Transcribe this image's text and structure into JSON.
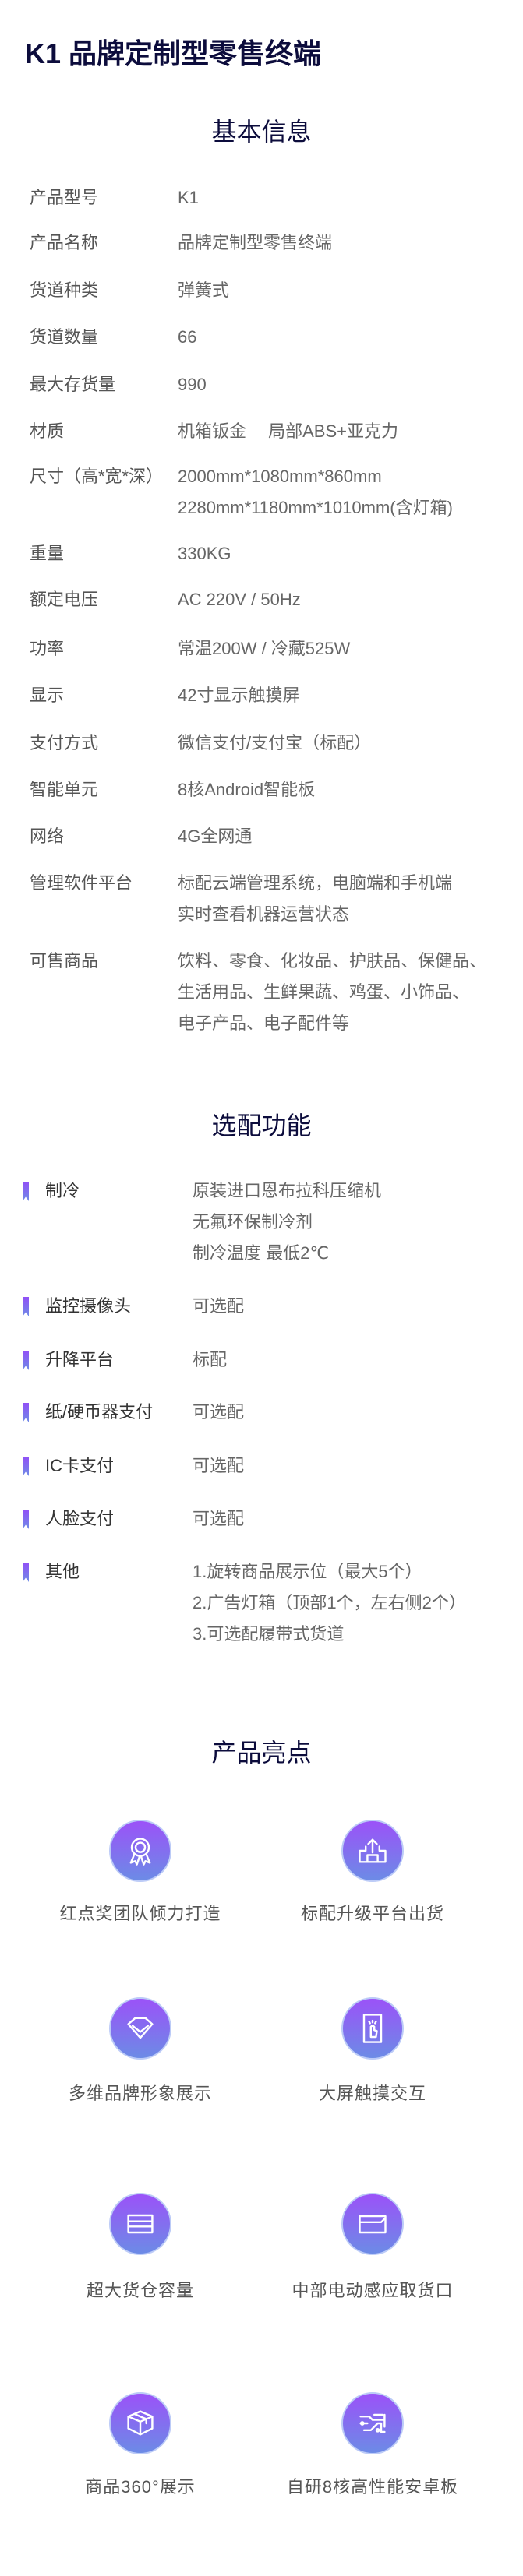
{
  "title": "K1 品牌定制型零售终端",
  "sections": {
    "basic": "基本信息",
    "options": "选配功能",
    "highlights": "产品亮点"
  },
  "specs": [
    {
      "label": "产品型号",
      "lines": [
        "K1"
      ]
    },
    {
      "label": "产品名称",
      "lines": [
        "品牌定制型零售终端"
      ]
    },
    {
      "label": "货道种类",
      "lines": [
        "弹簧式"
      ]
    },
    {
      "label": "货道数量",
      "lines": [
        "66"
      ]
    },
    {
      "label": "最大存货量",
      "lines": [
        "990"
      ]
    },
    {
      "label": "材质",
      "lines": [
        "机箱钣金　 局部ABS+亚克力"
      ]
    },
    {
      "label": "尺寸（高*宽*深）",
      "lines": [
        "2000mm*1080mm*860mm",
        "2280mm*1180mm*1010mm(含灯箱)"
      ]
    },
    {
      "label": "重量",
      "lines": [
        "330KG"
      ]
    },
    {
      "label": "额定电压",
      "lines": [
        "AC 220V / 50Hz"
      ]
    },
    {
      "label": "功率",
      "lines": [
        "常温200W / 冷藏525W"
      ]
    },
    {
      "label": "显示",
      "lines": [
        "42寸显示触摸屏"
      ]
    },
    {
      "label": "支付方式",
      "lines": [
        "微信支付/支付宝（标配）"
      ]
    },
    {
      "label": "智能单元",
      "lines": [
        "8核Android智能板"
      ]
    },
    {
      "label": "网络",
      "lines": [
        "4G全网通"
      ]
    },
    {
      "label": "管理软件平台",
      "lines": [
        "标配云端管理系统，电脑端和手机端",
        "实时查看机器运营状态"
      ]
    },
    {
      "label": "可售商品",
      "lines": [
        "饮料、零食、化妆品、护肤品、保健品、",
        "生活用品、生鲜果蔬、鸡蛋、小饰品、",
        "电子产品、电子配件等"
      ]
    }
  ],
  "options": [
    {
      "label": "制冷",
      "lines": [
        "原装进口恩布拉科压缩机",
        "无氟环保制冷剂",
        "制冷温度 最低2℃"
      ]
    },
    {
      "label": "监控摄像头",
      "lines": [
        "可选配"
      ]
    },
    {
      "label": "升降平台",
      "lines": [
        "标配"
      ]
    },
    {
      "label": "纸/硬币器支付",
      "lines": [
        "可选配"
      ]
    },
    {
      "label": "IC卡支付",
      "lines": [
        "可选配"
      ]
    },
    {
      "label": "人脸支付",
      "lines": [
        "可选配"
      ]
    },
    {
      "label": "其他",
      "lines": [
        "1.旋转商品展示位（最大5个）",
        "2.广告灯箱（顶部1个，左右侧2个）",
        "3.可选配履带式货道"
      ]
    }
  ],
  "highlights": [
    {
      "label": "红点奖团队倾力打造",
      "icon": "award-ribbon-icon"
    },
    {
      "label": "标配升级平台出货",
      "icon": "box-upload-icon"
    },
    {
      "label": "多维品牌形象展示",
      "icon": "diamond-icon"
    },
    {
      "label": "大屏触摸交互",
      "icon": "touch-screen-icon"
    },
    {
      "label": "超大货仓容量",
      "icon": "storage-shelves-icon"
    },
    {
      "label": "中部电动感应取货口",
      "icon": "pickup-port-icon"
    },
    {
      "label": "商品360°展示",
      "icon": "cube-icon"
    },
    {
      "label": "自研8核高性能安卓板",
      "icon": "circuit-board-icon"
    }
  ],
  "colors": {
    "accent_top": "#9b52f8",
    "accent_bottom": "#6c8be6",
    "heading": "#0c0c3c"
  }
}
